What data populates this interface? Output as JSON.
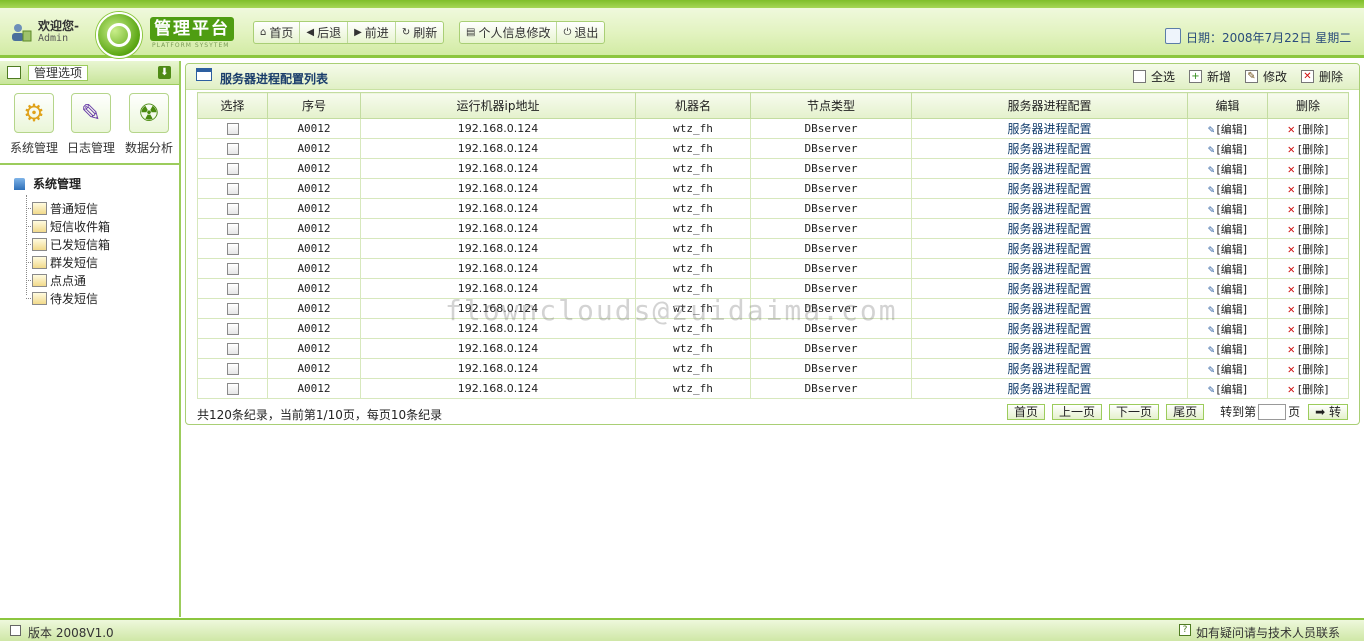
{
  "header": {
    "welcome": "欢迎您-",
    "username": "Admin",
    "logo_title": "管理平台",
    "logo_sub": "PLATFORM SYSYTEM",
    "nav": [
      {
        "label": "首页",
        "icon": "home-icon"
      },
      {
        "label": "后退",
        "icon": "back-icon"
      },
      {
        "label": "前进",
        "icon": "forward-icon"
      },
      {
        "label": "刷新",
        "icon": "refresh-icon"
      }
    ],
    "nav2": [
      {
        "label": "个人信息修改",
        "icon": "profile-icon"
      },
      {
        "label": "退出",
        "icon": "power-icon"
      }
    ],
    "date": "日期：2008年7月22日  星期二"
  },
  "sidebar": {
    "title": "管理选项",
    "quick": [
      {
        "label": "系统管理",
        "icon": "gears-icon"
      },
      {
        "label": "日志管理",
        "icon": "log-icon"
      },
      {
        "label": "数据分析",
        "icon": "radiation-icon"
      }
    ],
    "tree_root": "系统管理",
    "tree_items": [
      "普通短信",
      "短信收件箱",
      "已发短信箱",
      "群发短信",
      "点点通",
      "待发短信"
    ]
  },
  "panel": {
    "title": "服务器进程配置列表",
    "toolbar": {
      "select_all": "全选",
      "add": "新增",
      "edit": "修改",
      "delete": "删除"
    },
    "columns": [
      "选择",
      "序号",
      "运行机器ip地址",
      "机器名",
      "节点类型",
      "服务器进程配置",
      "编辑",
      "删除"
    ],
    "rows": [
      {
        "id": "A0012",
        "ip": "192.168.0.124",
        "host": "wtz_fh",
        "node": "DBserver",
        "config": "服务器进程配置"
      },
      {
        "id": "A0012",
        "ip": "192.168.0.124",
        "host": "wtz_fh",
        "node": "DBserver",
        "config": "服务器进程配置"
      },
      {
        "id": "A0012",
        "ip": "192.168.0.124",
        "host": "wtz_fh",
        "node": "DBserver",
        "config": "服务器进程配置"
      },
      {
        "id": "A0012",
        "ip": "192.168.0.124",
        "host": "wtz_fh",
        "node": "DBserver",
        "config": "服务器进程配置"
      },
      {
        "id": "A0012",
        "ip": "192.168.0.124",
        "host": "wtz_fh",
        "node": "DBserver",
        "config": "服务器进程配置"
      },
      {
        "id": "A0012",
        "ip": "192.168.0.124",
        "host": "wtz_fh",
        "node": "DBserver",
        "config": "服务器进程配置"
      },
      {
        "id": "A0012",
        "ip": "192.168.0.124",
        "host": "wtz_fh",
        "node": "DBserver",
        "config": "服务器进程配置"
      },
      {
        "id": "A0012",
        "ip": "192.168.0.124",
        "host": "wtz_fh",
        "node": "DBserver",
        "config": "服务器进程配置"
      },
      {
        "id": "A0012",
        "ip": "192.168.0.124",
        "host": "wtz_fh",
        "node": "DBserver",
        "config": "服务器进程配置"
      },
      {
        "id": "A0012",
        "ip": "192.168.0.124",
        "host": "wtz_fh",
        "node": "DBserver",
        "config": "服务器进程配置"
      },
      {
        "id": "A0012",
        "ip": "192.168.0.124",
        "host": "wtz_fh",
        "node": "DBserver",
        "config": "服务器进程配置"
      },
      {
        "id": "A0012",
        "ip": "192.168.0.124",
        "host": "wtz_fh",
        "node": "DBserver",
        "config": "服务器进程配置"
      },
      {
        "id": "A0012",
        "ip": "192.168.0.124",
        "host": "wtz_fh",
        "node": "DBserver",
        "config": "服务器进程配置"
      },
      {
        "id": "A0012",
        "ip": "192.168.0.124",
        "host": "wtz_fh",
        "node": "DBserver",
        "config": "服务器进程配置"
      }
    ],
    "edit_label": "[编辑]",
    "delete_label": "[删除]",
    "record_text": "共120条纪录，当前第1/10页，每页10条纪录",
    "pager": {
      "first": "首页",
      "prev": "上一页",
      "next": "下一页",
      "last": "尾页",
      "goto_prefix": "转到第",
      "goto_suffix": "页",
      "go": "转"
    }
  },
  "watermark": "flownclouds@zuidaima.com",
  "status": {
    "version": "版本 2008V1.0",
    "help": "如有疑问请与技术人员联系"
  }
}
